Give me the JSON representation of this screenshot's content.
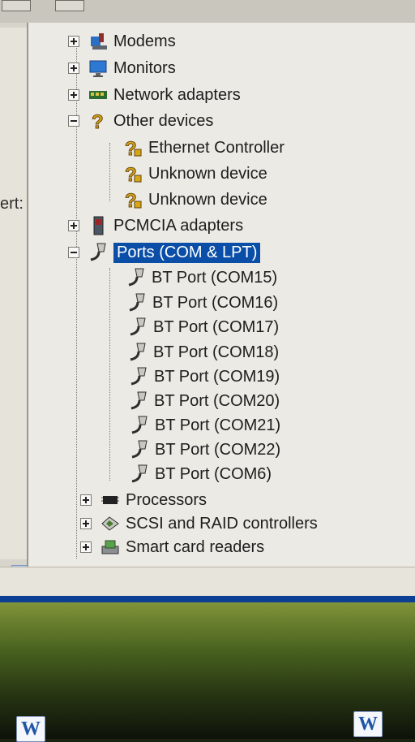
{
  "left_pane": {
    "partial_label": "ert:"
  },
  "tree": {
    "items": [
      {
        "label": "Modems",
        "expander": "plus"
      },
      {
        "label": "Monitors",
        "expander": "plus"
      },
      {
        "label": "Network adapters",
        "expander": "plus"
      },
      {
        "label": "Other devices",
        "expander": "minus"
      },
      {
        "label": "Ethernet Controller",
        "expander": "none"
      },
      {
        "label": "Unknown device",
        "expander": "none"
      },
      {
        "label": "Unknown device",
        "expander": "none"
      },
      {
        "label": "PCMCIA adapters",
        "expander": "plus"
      },
      {
        "label": "Ports (COM & LPT)",
        "expander": "minus",
        "selected": true
      },
      {
        "label": "BT Port (COM15)",
        "expander": "none"
      },
      {
        "label": "BT Port (COM16)",
        "expander": "none"
      },
      {
        "label": "BT Port (COM17)",
        "expander": "none"
      },
      {
        "label": "BT Port (COM18)",
        "expander": "none"
      },
      {
        "label": "BT Port (COM19)",
        "expander": "none"
      },
      {
        "label": "BT Port (COM20)",
        "expander": "none"
      },
      {
        "label": "BT Port (COM21)",
        "expander": "none"
      },
      {
        "label": "BT Port (COM22)",
        "expander": "none"
      },
      {
        "label": "BT Port (COM6)",
        "expander": "none"
      },
      {
        "label": "Processors",
        "expander": "plus"
      },
      {
        "label": "SCSI and RAID controllers",
        "expander": "plus"
      },
      {
        "label": "Smart card readers",
        "expander": "plus"
      }
    ]
  },
  "taskbar": {
    "word_icon_letter": "W"
  },
  "colors": {
    "selection": "#0a4ea8",
    "tree_background": "#eceae4",
    "taskbar_strip": "#0c3f93"
  }
}
